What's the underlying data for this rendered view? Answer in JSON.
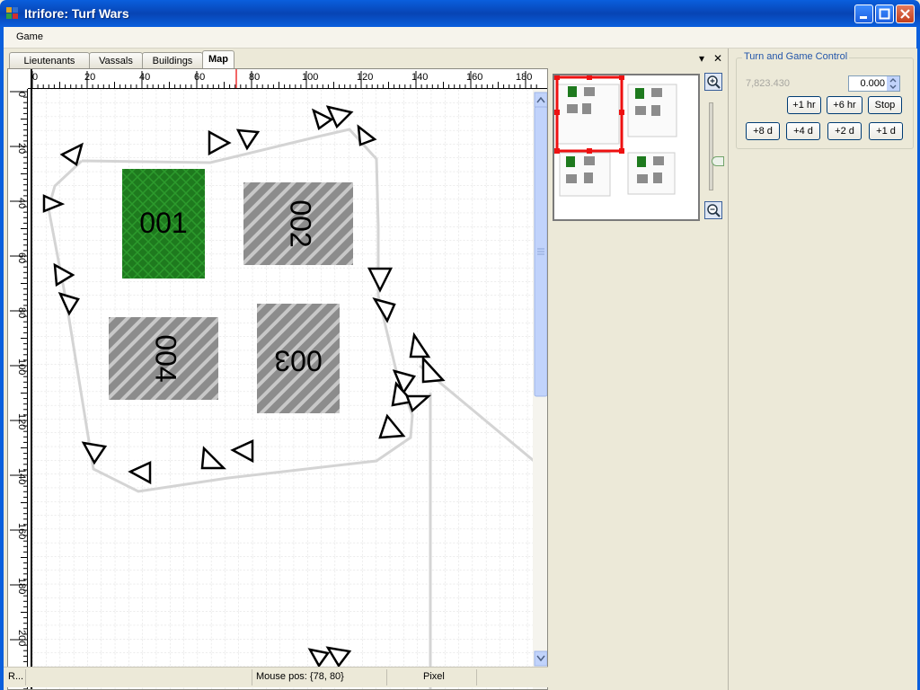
{
  "window": {
    "title": "Itrifore: Turf Wars"
  },
  "menu": {
    "game": "Game"
  },
  "tabs": [
    {
      "label": "Lieutenants"
    },
    {
      "label": "Vassals"
    },
    {
      "label": "Buildings"
    },
    {
      "label": "Map",
      "active": true
    }
  ],
  "tab_controls": {
    "dropdown": "▾",
    "close": "✕"
  },
  "ruler": {
    "x_labels": [
      "0",
      "20",
      "40",
      "60",
      "80",
      "100",
      "120",
      "140",
      "160",
      "180"
    ],
    "y_labels": [
      "0",
      "20",
      "40",
      "60",
      "80",
      "100",
      "120",
      "140",
      "160",
      "180",
      "200"
    ]
  },
  "buildings": [
    {
      "label": "001",
      "color": "#1e7a1e",
      "rotated": false
    },
    {
      "label": "002",
      "color": "#8c8c8c",
      "rotated": true
    },
    {
      "label": "003",
      "color": "#8c8c8c",
      "rotated": true
    },
    {
      "label": "004",
      "color": "#8c8c8c",
      "rotated": true
    }
  ],
  "status": {
    "left": "R...",
    "mouse_pos": "Mouse pos: {78, 80}",
    "unit": "Pixel"
  },
  "turn_control": {
    "title": "Turn and Game Control",
    "date_value": "7,823.430",
    "spin_value": "0.000",
    "buttons_row1": [
      "+1 hr",
      "+6 hr",
      "Stop"
    ],
    "buttons_row2": [
      "+8 d",
      "+4 d",
      "+2 d",
      "+1 d"
    ]
  },
  "colors": {
    "accent": "#0a5fdd",
    "selection": "#ee1111"
  }
}
